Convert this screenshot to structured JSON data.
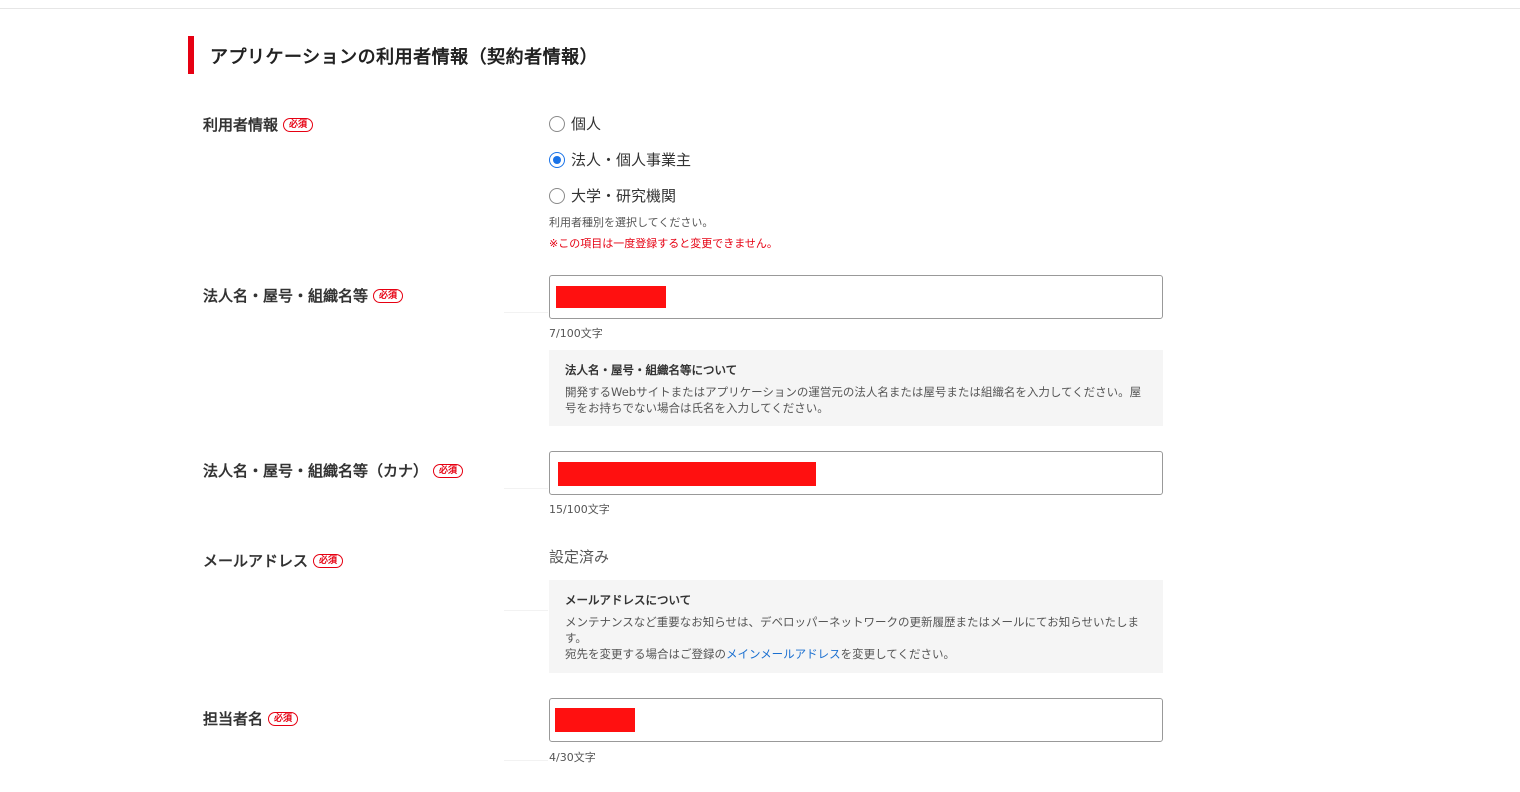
{
  "section": {
    "title": "アプリケーションの利用者情報（契約者情報）"
  },
  "required_badge": "必須",
  "user_info": {
    "label": "利用者情報",
    "options": [
      {
        "label": "個人",
        "checked": false
      },
      {
        "label": "法人・個人事業主",
        "checked": true
      },
      {
        "label": "大学・研究機関",
        "checked": false
      }
    ],
    "help": "利用者種別を選択してください。",
    "warning": "※この項目は一度登録すると変更できません。"
  },
  "org_name": {
    "label": "法人名・屋号・組織名等",
    "counter": "7/100文字",
    "note_title": "法人名・屋号・組織名等について",
    "note_body": "開発するWebサイトまたはアプリケーションの運営元の法人名または屋号または組織名を入力してください。屋号をお持ちでない場合は氏名を入力してください。"
  },
  "org_name_kana": {
    "label": "法人名・屋号・組織名等（カナ）",
    "counter": "15/100文字"
  },
  "email": {
    "label": "メールアドレス",
    "value": "設定済み",
    "note_title": "メールアドレスについて",
    "note_line1": "メンテナンスなど重要なお知らせは、デベロッパーネットワークの更新履歴またはメールにてお知らせいたします。",
    "note_line2_prefix": "宛先を変更する場合はご登録の",
    "note_link": "メインメールアドレス",
    "note_line2_suffix": "を変更してください。"
  },
  "contact_name": {
    "label": "担当者名",
    "counter": "4/30文字"
  },
  "colors": {
    "accent": "#e60012",
    "link": "#1a6fd0",
    "radio_checked": "#1a73e8",
    "redaction": "#ff1010"
  }
}
